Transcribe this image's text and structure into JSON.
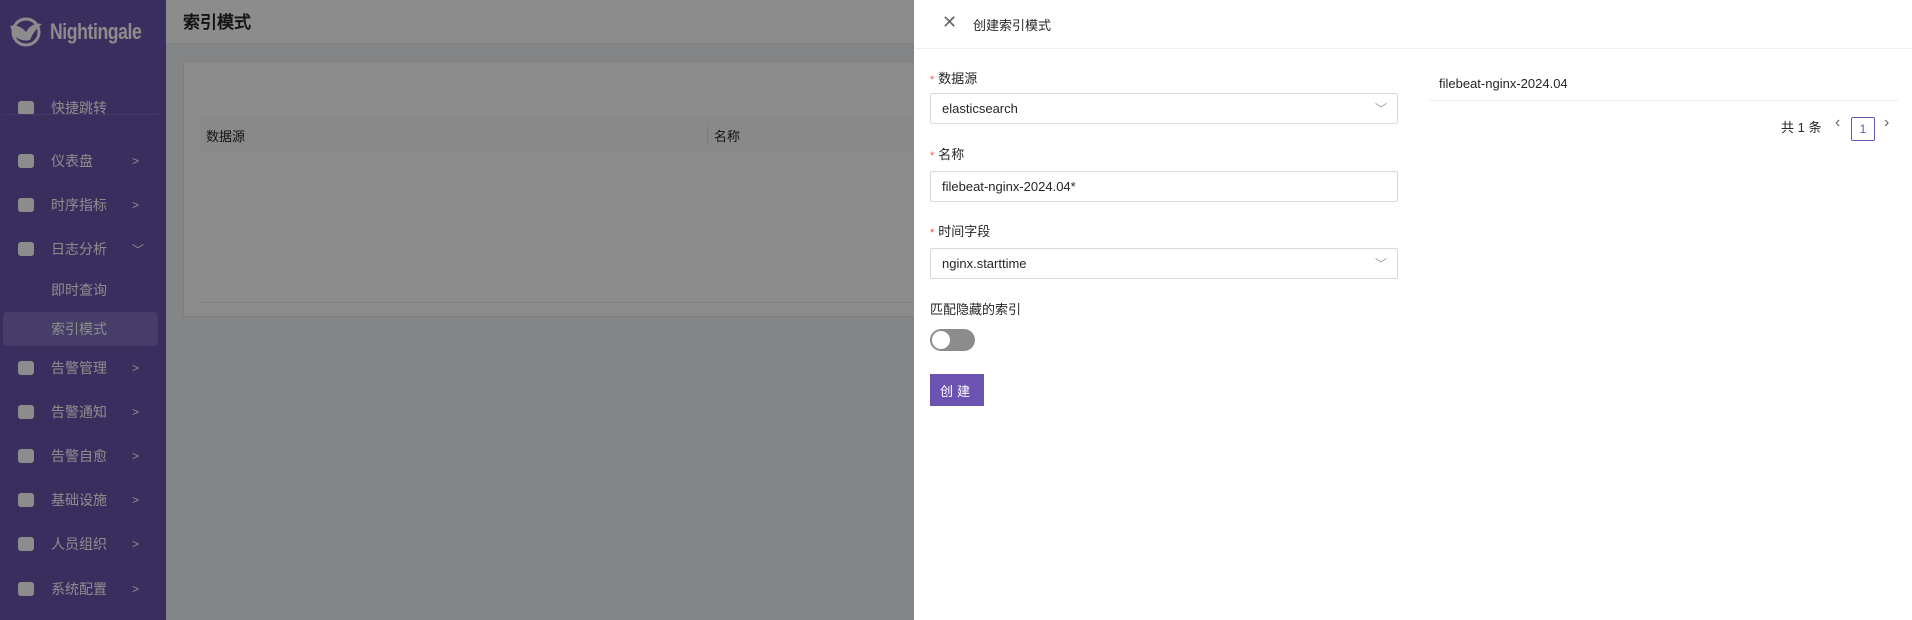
{
  "app": {
    "logo_text": "Nightingale"
  },
  "sidebar": {
    "items": [
      {
        "label": "快捷跳转",
        "icon": "search-icon"
      },
      {
        "label": "仪表盘",
        "icon": "dashboard-icon",
        "chevron": ">"
      },
      {
        "label": "时序指标",
        "icon": "chart-line-icon",
        "chevron": ">"
      },
      {
        "label": "日志分析",
        "icon": "log-icon",
        "chevron": "﹀"
      },
      {
        "label": "即时查询"
      },
      {
        "label": "索引模式",
        "selected": true
      },
      {
        "label": "告警管理",
        "icon": "alarm-icon",
        "chevron": ">"
      },
      {
        "label": "告警通知",
        "icon": "megaphone-icon",
        "chevron": ">"
      },
      {
        "label": "告警自愈",
        "icon": "terminal-icon",
        "chevron": ">"
      },
      {
        "label": "基础设施",
        "icon": "server-icon",
        "chevron": ">"
      },
      {
        "label": "人员组织",
        "icon": "user-icon",
        "chevron": ">"
      },
      {
        "label": "系统配置",
        "icon": "grid-icon",
        "chevron": ">"
      }
    ]
  },
  "page": {
    "title": "索引模式",
    "table": {
      "columns": [
        "数据源",
        "名称"
      ]
    }
  },
  "drawer": {
    "title": "创建索引模式",
    "close_icon": "close-icon",
    "fields": {
      "datasource": {
        "label": "数据源",
        "value": "elasticsearch"
      },
      "name": {
        "label": "名称",
        "value": "filebeat-nginx-2024.04*"
      },
      "time_field": {
        "label": "时间字段",
        "value": "nginx.starttime"
      },
      "hidden": {
        "label": "匹配隐藏的索引",
        "enabled": false
      }
    },
    "submit_label": "创建",
    "matches": [
      "filebeat-nginx-2024.04"
    ],
    "pagination": {
      "total_text": "共 1 条",
      "current": "1",
      "prev": "‹",
      "next": "›"
    }
  },
  "colors": {
    "brand": "#6c53b1",
    "required": "#ff4d4f"
  }
}
